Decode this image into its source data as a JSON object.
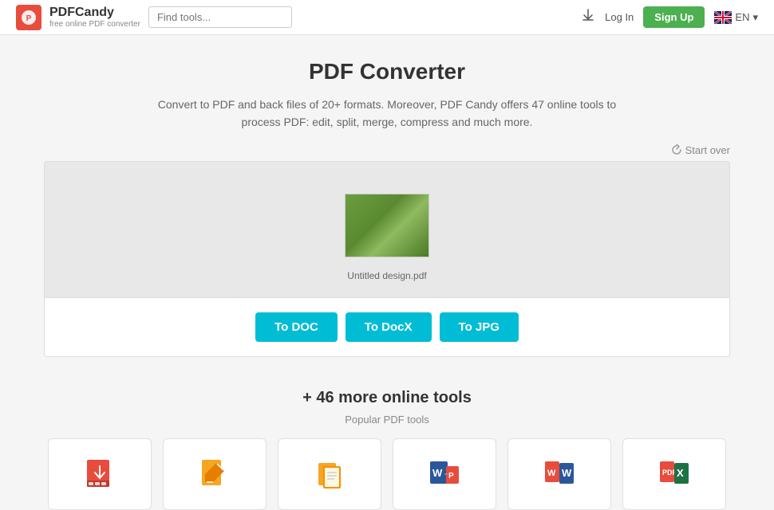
{
  "header": {
    "logo_brand": "PDFCandy",
    "logo_tagline": "free online PDF converter",
    "search_placeholder": "Find tools...",
    "download_icon": "download-icon",
    "login_label": "Log In",
    "signup_label": "Sign Up",
    "language": "EN"
  },
  "main": {
    "title": "PDF Converter",
    "subtitle_line1": "Convert to PDF and back files of 20+ formats. Moreover, PDF Candy offers 47 online tools to",
    "subtitle_line2": "process PDF: edit, split, merge, compress and much more.",
    "start_over": "Start over",
    "file_name": "Untitled design.pdf",
    "buttons": [
      {
        "label": "To DOC"
      },
      {
        "label": "To DocX"
      },
      {
        "label": "To JPG"
      }
    ]
  },
  "more_tools": {
    "title": "+ 46 more online tools",
    "popular_label": "Popular PDF tools",
    "tools": [
      {
        "id": "pdf-download",
        "icon": "pdf-download-icon"
      },
      {
        "id": "pdf-edit",
        "icon": "pdf-edit-icon"
      },
      {
        "id": "pdf-to-pdf",
        "icon": "pdf-pages-icon"
      },
      {
        "id": "word-to-pdf",
        "icon": "word-pdf-icon"
      },
      {
        "id": "pdf-to-word",
        "icon": "pdf-word-icon"
      },
      {
        "id": "pdf-to-excel",
        "icon": "pdf-excel-icon"
      }
    ]
  }
}
